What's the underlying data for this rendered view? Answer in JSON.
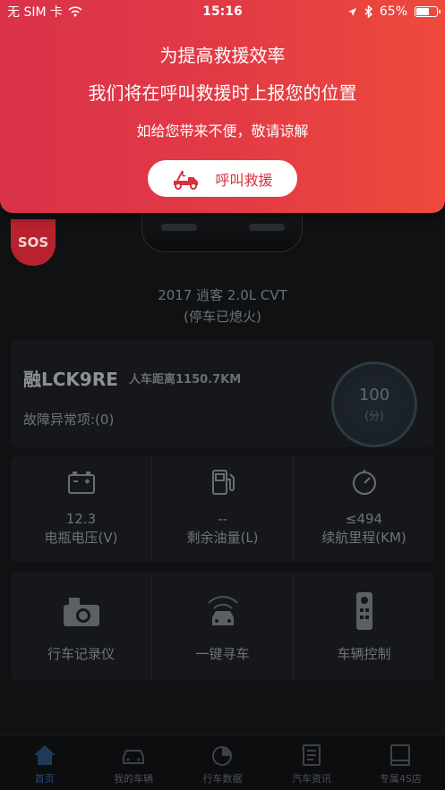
{
  "status_bar": {
    "carrier": "无 SIM 卡",
    "time": "15:16",
    "battery": "65%",
    "battery_level": 0.65
  },
  "alert": {
    "line1": "为提高救援效率",
    "line2": "我们将在呼叫救援时上报您的位置",
    "line3": "如给您带来不便，敬请谅解",
    "button_label": "呼叫救援"
  },
  "sos_label": "SOS",
  "car": {
    "model": "2017 逍客 2.0L CVT",
    "state": "(停车已熄火)"
  },
  "health": {
    "plate": "融LCK9RE",
    "distance": "人车距离1150.7KM",
    "fault": "故障异常项:(0)",
    "score": "100",
    "score_unit": "(分)"
  },
  "stats": [
    {
      "icon": "battery-icon",
      "value": "12.3",
      "label": "电瓶电压(V)"
    },
    {
      "icon": "fuel-pump-icon",
      "value": "--",
      "label": "剩余油量(L)"
    },
    {
      "icon": "range-gauge-icon",
      "value": "≤494",
      "label": "续航里程(KM)"
    }
  ],
  "tools": [
    {
      "icon": "dashcam-icon",
      "label": "行车记录仪"
    },
    {
      "icon": "find-car-icon",
      "label": "一键寻车"
    },
    {
      "icon": "remote-control-icon",
      "label": "车辆控制"
    }
  ],
  "tabs": [
    {
      "icon": "home-icon",
      "label": "首页",
      "active": true
    },
    {
      "icon": "car-icon",
      "label": "我的车辆"
    },
    {
      "icon": "pie-chart-icon",
      "label": "行车数据"
    },
    {
      "icon": "news-icon",
      "label": "汽车资讯"
    },
    {
      "icon": "4s-store-icon",
      "label": "专属4S店"
    }
  ],
  "colors": {
    "alert_start": "#d9324a",
    "alert_end": "#ee4a3c",
    "sos": "#b8222e",
    "active_tab": "#2a4d74"
  }
}
